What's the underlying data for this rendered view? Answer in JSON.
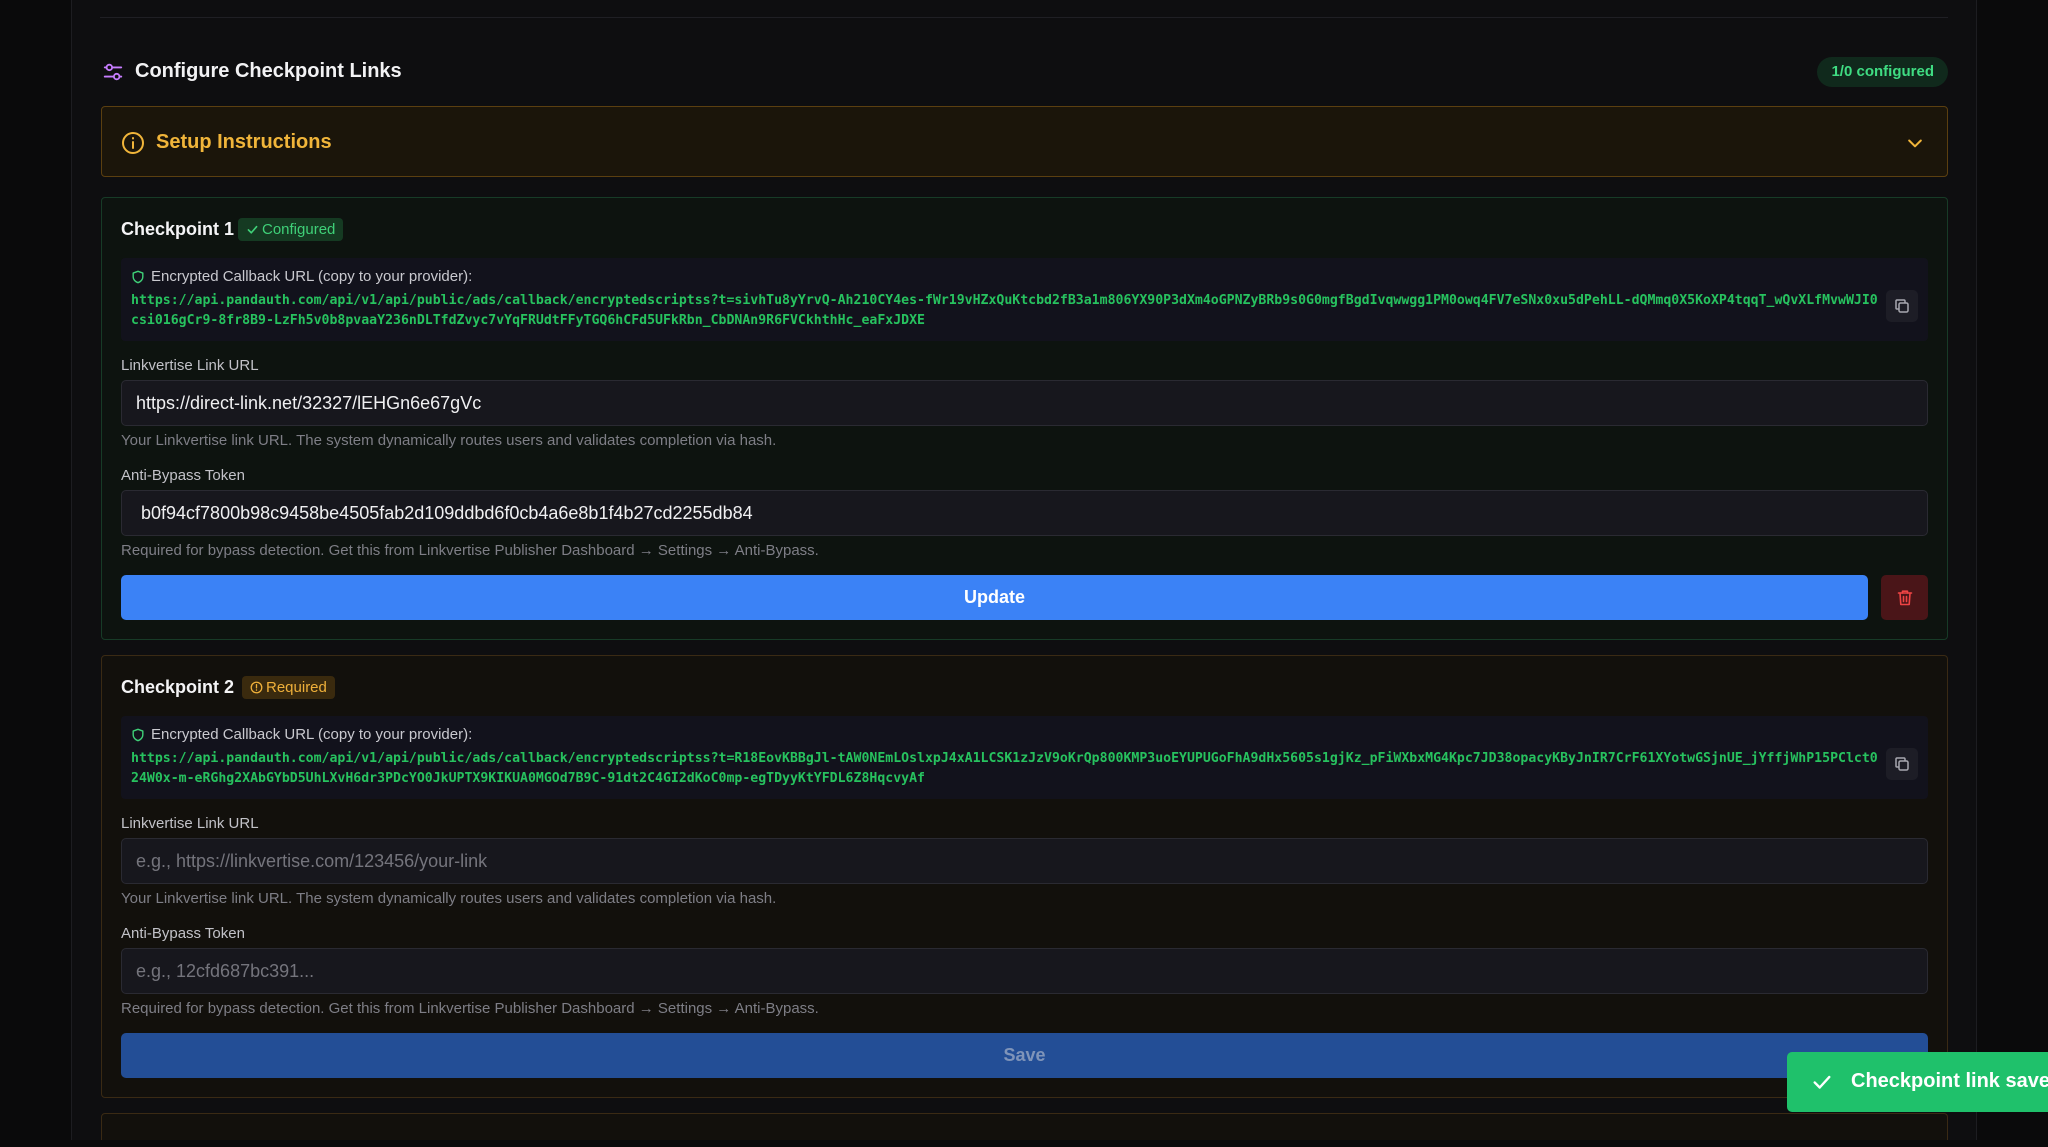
{
  "header": {
    "title": "Configure Checkpoint Links",
    "status": "1/0 configured"
  },
  "instructions": {
    "title": "Setup Instructions"
  },
  "checkpoints": [
    {
      "title": "Checkpoint 1",
      "badge": "Configured",
      "callback_label": "Encrypted Callback URL (copy to your provider):",
      "callback_url": "https://api.pandauth.com/api/v1/api/public/ads/callback/encryptedscriptss?t=sivhTu8yYrvQ-Ah210CY4es-fWr19vHZxQuKtcbd2fB3a1m806YX90P3dXm4oGPNZyBRb9s0G0mgfBgdIvqwwgg1PM0owq4FV7eSNx0xu5dPehLL-dQMmq0X5KoXP4tqqT_wQvXLfMvwWJI0csi016gCr9-8fr8B9-LzFh5v0b8pvaaY236nDLTfdZvyc7vYqFRUdtFFyTGQ6hCFd5UFkRbn_CbDNAn9R6FVCkhthHc_eaFxJDXE",
      "link_label": "Linkvertise Link URL",
      "link_value": "https://direct-link.net/32327/lEHGn6e67gVc",
      "link_placeholder": "e.g., https://linkvertise.com/123456/your-link",
      "link_hint": "Your Linkvertise link URL. The system dynamically routes users and validates completion via hash.",
      "token_label": "Anti-Bypass Token",
      "token_value": "b0f94cf7800b98c9458be4505fab2d109ddbd6f0cb4a6e8b1f4b27cd2255db84",
      "token_placeholder": "e.g., 12cfd687bc391...",
      "token_hint": "Required for bypass detection. Get this from Linkvertise Publisher Dashboard → Settings → Anti-Bypass.",
      "action_label": "Update"
    },
    {
      "title": "Checkpoint 2",
      "badge": "Required",
      "callback_label": "Encrypted Callback URL (copy to your provider):",
      "callback_url": "https://api.pandauth.com/api/v1/api/public/ads/callback/encryptedscriptss?t=R18EovKBBgJl-tAW0NEmLOslxpJ4xA1LCSK1zJzV9oKrQp800KMP3uoEYUPUGoFhA9dHx5605s1gjKz_pFiWXbxMG4Kpc7JD38opacyKByJnIR7CrF61XYotwGSjnUE_jYffjWhP15PClct024W0x-m-eRGhg2XAbGYbD5UhLXvH6dr3PDcYO0JkUPTX9KIKUA0MGOd7B9C-91dt2C4GI2dKoC0mp-egTDyyKtYFDL6Z8HqcvyAf",
      "link_label": "Linkvertise Link URL",
      "link_value": "",
      "link_placeholder": "e.g., https://linkvertise.com/123456/your-link",
      "link_hint": "Your Linkvertise link URL. The system dynamically routes users and validates completion via hash.",
      "token_label": "Anti-Bypass Token",
      "token_value": "",
      "token_placeholder": "e.g., 12cfd687bc391...",
      "token_hint": "Required for bypass detection. Get this from Linkvertise Publisher Dashboard → Settings → Anti-Bypass.",
      "action_label": "Save"
    }
  ],
  "toast": {
    "message": "Checkpoint link saved"
  },
  "colors": {
    "accent_blue": "#3b82f6",
    "success_green": "#1fc16b",
    "warning_amber": "#f1b53a",
    "callback_text": "#27c25f",
    "danger": "#ef4444"
  },
  "icons": {
    "header": "sliders-icon",
    "instructions": "info-circle-icon",
    "expand": "chevron-down-icon",
    "configured": "check-icon",
    "required": "alert-circle-icon",
    "callback": "shield-icon",
    "copy": "copy-icon",
    "delete": "trash-icon",
    "toast": "check-icon"
  }
}
